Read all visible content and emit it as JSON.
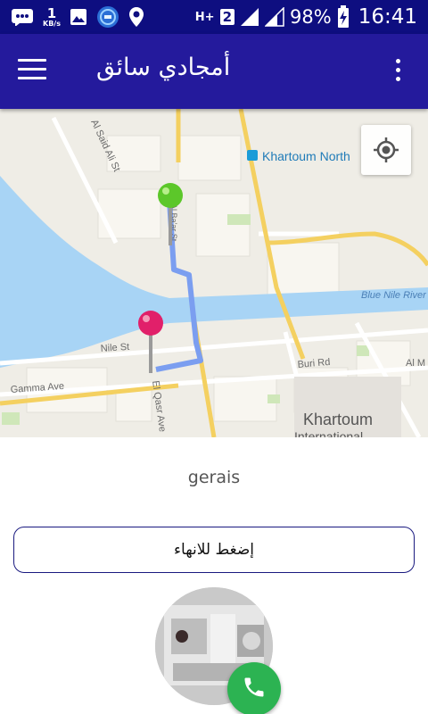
{
  "status_bar": {
    "net_speed_value": "1",
    "net_speed_unit": "KB/s",
    "network_type": "H+",
    "sim_slot": "2",
    "battery_percent": "98%",
    "time": "16:41",
    "icons": [
      "message-icon",
      "image-icon",
      "app-notification-icon",
      "location-icon",
      "signal-icon",
      "signal-icon",
      "battery-charging-icon"
    ]
  },
  "app_bar": {
    "title": "أمجادي سائق",
    "menu_icon": "menu-icon",
    "overflow_icon": "more-vert-icon",
    "color": "#241a9c"
  },
  "map": {
    "labels": {
      "khartoum_north": "Khartoum North",
      "blue_nile": "Blue Nile River",
      "nile_st": "Nile St",
      "buri_rd": "Buri Rd",
      "al_m": "Al M",
      "gamma_ave": "Gamma Ave",
      "khartoum": "Khartoum",
      "international": "International",
      "el_qasr_ave": "El Qasr Ave",
      "al_said_ali_st": "Al Said Ali St",
      "street_n": "Al Ba'ar St"
    },
    "markers": [
      {
        "type": "origin",
        "color": "#5cc72a"
      },
      {
        "type": "destination",
        "color": "#e1206a"
      }
    ],
    "route_color": "#7b9ef0",
    "locate_icon": "my-location-icon"
  },
  "driver": {
    "name": "gerais"
  },
  "finish_button": {
    "label": "إضغط للانهاء"
  },
  "call_button": {
    "icon": "phone-icon",
    "color": "#2cb352"
  }
}
